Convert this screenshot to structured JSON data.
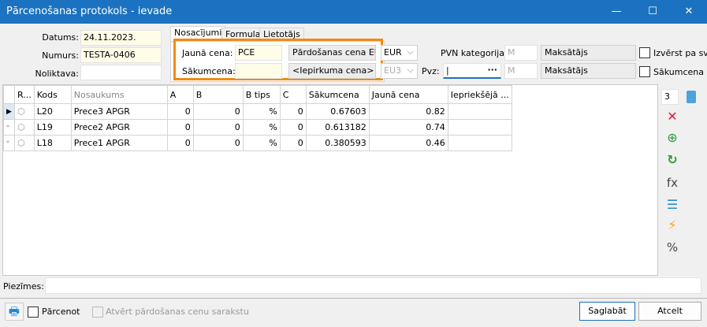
{
  "window": {
    "title": "Pārcenošanas protokols - ievade",
    "min": "—",
    "max": "☐",
    "close": "✕"
  },
  "header": {
    "datums_label": "Datums:",
    "datums": "24.11.2023.",
    "numurs_label": "Numurs:",
    "numurs": "TESTA-0406",
    "noliktava_label": "Noliktava:",
    "noliktava": ""
  },
  "tabs": [
    "Nosacījumi",
    "Formula",
    "Lietotājs"
  ],
  "conditions": {
    "jauna_cena_label": "Jaunā cena:",
    "jauna_cena": "PCE",
    "jauna_cena_name": "Pārdošanas cena EUR",
    "sakumcena_label": "Sākumcena:",
    "sakumcena": "",
    "sakumcena_name": "<Iepirkuma cena>",
    "currency1": "EUR",
    "currency2": "EU3",
    "pvz_label": "Pvz:",
    "pvz_dots": "···",
    "pvn_label": "PVN kategorija:",
    "pvn1": "M",
    "pvn1_name": "Maksātājs",
    "pvn2": "M",
    "pvn2_name": "Maksātājs",
    "izverst_label": "Izvērst pa sv",
    "sakumcena_chk_label": "Sākumcena p"
  },
  "grid": {
    "columns": [
      "R...",
      "Kods",
      "Nosaukums",
      "A",
      "B",
      "B tips",
      "C",
      "Sākumcena",
      "Jaunā cena",
      "Iepriekšējā ..."
    ],
    "rows": [
      {
        "kods": "L20",
        "nos": "Prece3 APGR",
        "a": "0",
        "b": "0",
        "btips": "%",
        "c": "0",
        "sak": "0.67603",
        "jauna": "0.82",
        "iepr": ""
      },
      {
        "kods": "L19",
        "nos": "Prece2 APGR",
        "a": "0",
        "b": "0",
        "btips": "%",
        "c": "0",
        "sak": "0.613182",
        "jauna": "0.74",
        "iepr": ""
      },
      {
        "kods": "L18",
        "nos": "Prece1 APGR",
        "a": "0",
        "b": "0",
        "btips": "%",
        "c": "0",
        "sak": "0.380593",
        "jauna": "0.46",
        "iepr": ""
      }
    ]
  },
  "toolbar": {
    "count": "3",
    "fx": "fx",
    "percent": "%"
  },
  "notes": {
    "label": "Piezīmes:",
    "value": ""
  },
  "footer": {
    "parcenot": "Pārcenot",
    "atvert": "Atvērt pārdošanas cenu sarakstu",
    "save": "Saglabāt",
    "cancel": "Atcelt"
  }
}
